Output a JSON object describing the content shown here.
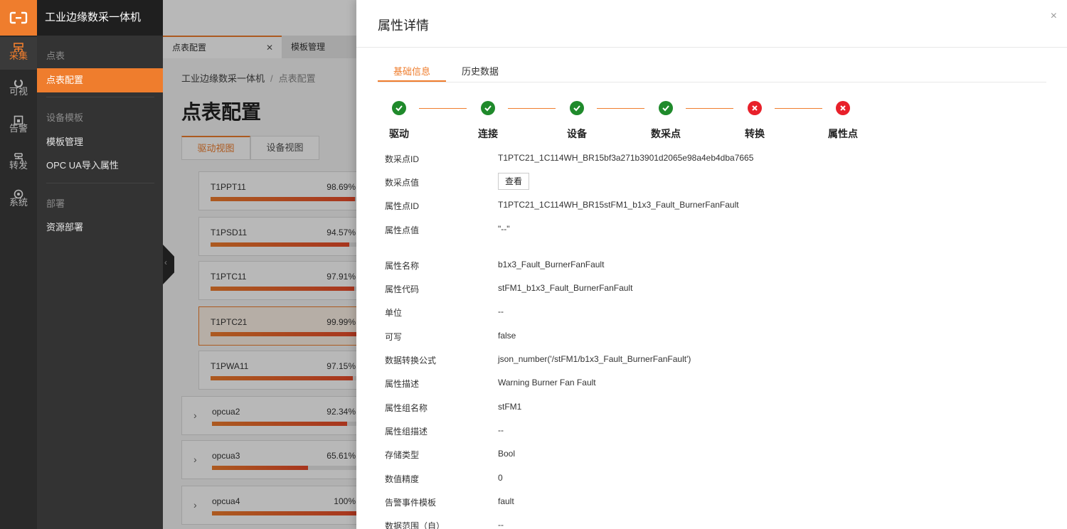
{
  "header": {
    "app_title": "工业边缘数采一体机",
    "logo_icon": "brand-logo-icon"
  },
  "rail": [
    {
      "label": "采集",
      "icon": "collect-icon"
    },
    {
      "label": "可视",
      "icon": "visual-icon"
    },
    {
      "label": "告警",
      "icon": "alarm-icon"
    },
    {
      "label": "转发",
      "icon": "forward-icon"
    },
    {
      "label": "系统",
      "icon": "system-icon"
    }
  ],
  "subnav": {
    "group1": "点表",
    "item1": "点表配置",
    "group2": "设备模板",
    "item2": "模板管理",
    "item3": "OPC UA导入属性",
    "group3": "部署",
    "item4": "资源部署"
  },
  "tabs": [
    {
      "label": "点表配置"
    },
    {
      "label": "模板管理"
    }
  ],
  "breadcrumb": {
    "root": "工业边缘数采一体机",
    "sep": "/",
    "current": "点表配置"
  },
  "page_title": "点表配置",
  "view_tabs": [
    "驱动视图",
    "设备视图"
  ],
  "cards": [
    {
      "name": "T1PPT11",
      "pct": "98.69%",
      "fill": 0.9869
    },
    {
      "name": "T1PSD11",
      "pct": "94.57%",
      "fill": 0.9457
    },
    {
      "name": "T1PTC11",
      "pct": "97.91%",
      "fill": 0.9791
    },
    {
      "name": "T1PTC21",
      "pct": "99.99%",
      "fill": 0.9999
    },
    {
      "name": "T1PWA11",
      "pct": "97.15%",
      "fill": 0.9715
    },
    {
      "name": "opcua2",
      "pct": "92.34%",
      "fill": 0.9234
    },
    {
      "name": "opcua3",
      "pct": "65.61%",
      "fill": 0.6561
    },
    {
      "name": "opcua4",
      "pct": "100%",
      "fill": 1.0
    }
  ],
  "drawer": {
    "title": "属性详情",
    "close": "×",
    "tabs": [
      "基础信息",
      "历史数据"
    ],
    "steps": [
      {
        "label": "驱动",
        "status": "ok"
      },
      {
        "label": "连接",
        "status": "ok"
      },
      {
        "label": "设备",
        "status": "ok"
      },
      {
        "label": "数采点",
        "status": "ok"
      },
      {
        "label": "转换",
        "status": "error"
      },
      {
        "label": "属性点",
        "status": "error"
      }
    ],
    "view_button": "查看",
    "rows": [
      {
        "label": "数采点ID",
        "value": "T1PTC21_1C114WH_BR15bf3a271b3901d2065e98a4eb4dba7665"
      },
      {
        "label": "数采点值",
        "value": ""
      },
      {
        "label": "属性点ID",
        "value": "T1PTC21_1C114WH_BR15stFM1_b1x3_Fault_BurnerFanFault"
      },
      {
        "label": "属性点值",
        "value": "\"--\""
      },
      {
        "label": "属性名称",
        "value": "b1x3_Fault_BurnerFanFault"
      },
      {
        "label": "属性代码",
        "value": "stFM1_b1x3_Fault_BurnerFanFault"
      },
      {
        "label": "单位",
        "value": "--"
      },
      {
        "label": "可写",
        "value": "false"
      },
      {
        "label": "数据转换公式",
        "value": "json_number('/stFM1/b1x3_Fault_BurnerFanFault')"
      },
      {
        "label": "属性描述",
        "value": "Warning Burner Fan Fault"
      },
      {
        "label": "属性组名称",
        "value": "stFM1"
      },
      {
        "label": "属性组描述",
        "value": "--"
      },
      {
        "label": "存储类型",
        "value": "Bool"
      },
      {
        "label": "数值精度",
        "value": "0"
      },
      {
        "label": "告警事件模板",
        "value": "fault"
      },
      {
        "label": "数据范围（自）",
        "value": "--"
      }
    ]
  },
  "colors": {
    "accent": "#ef7d2d",
    "ok": "#1f8a2b",
    "error": "#e8202a"
  }
}
